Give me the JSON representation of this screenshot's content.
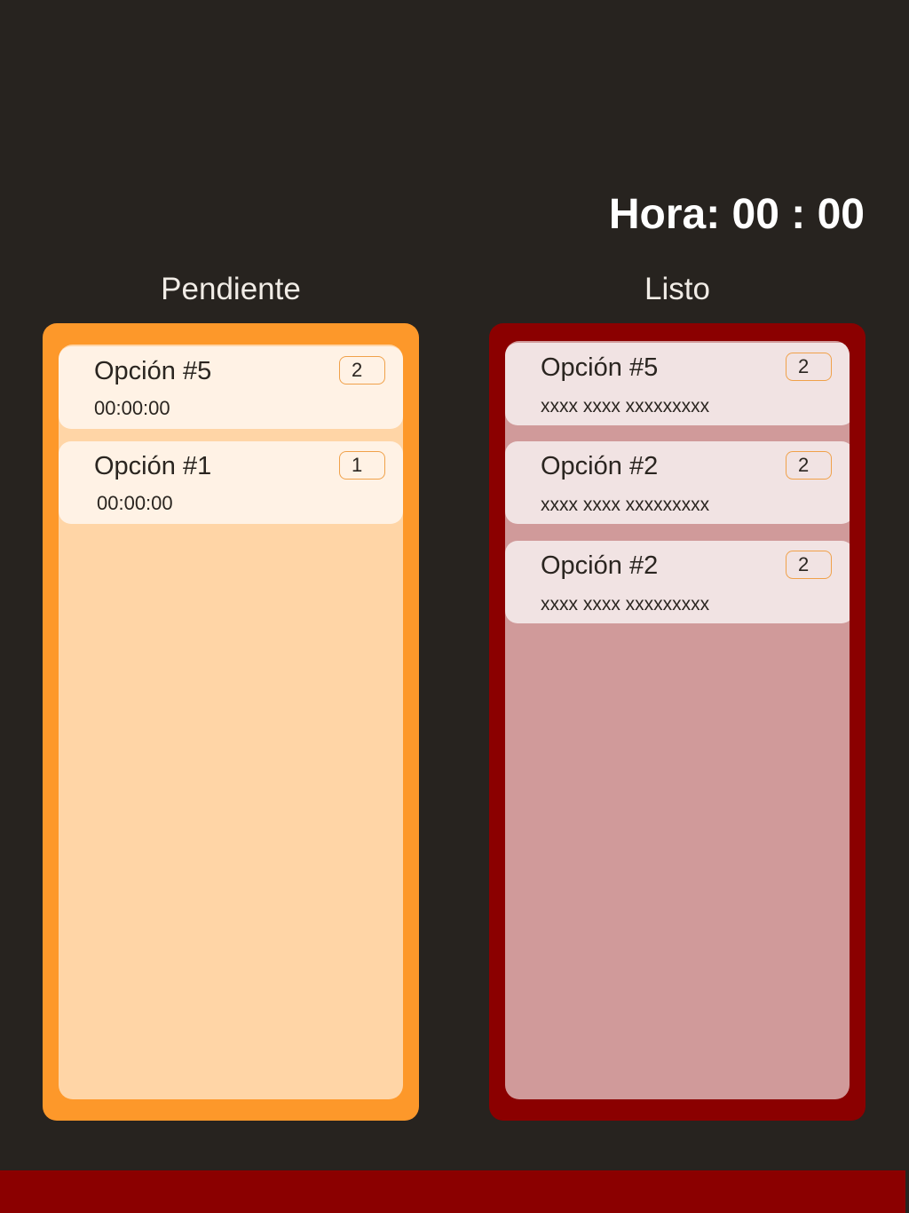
{
  "header": {
    "clock_text": "Hora: 00 : 00"
  },
  "columns": {
    "pending": {
      "title": "Pendiente",
      "cards": [
        {
          "title": "Opción #5",
          "qty": "2",
          "subtitle": "00:00:00"
        },
        {
          "title": "Opción #1",
          "qty": "1",
          "subtitle": "00:00:00"
        }
      ]
    },
    "done": {
      "title": "Listo",
      "cards": [
        {
          "title": "Opción #5",
          "qty": "2",
          "subtitle": "xxxx xxxx xxxxxxxxx"
        },
        {
          "title": "Opción #2",
          "qty": "2",
          "subtitle": "xxxx xxxx xxxxxxxxx"
        },
        {
          "title": "Opción #2",
          "qty": "2",
          "subtitle": "xxxx xxxx xxxxxxxxx"
        }
      ]
    }
  },
  "colors": {
    "background": "#27231f",
    "pending_accent": "#fd982a",
    "pending_panel": "#ffd5a6",
    "done_accent": "#8b0000",
    "done_panel": "#d09a9a",
    "qty_border": "#f0a14a"
  }
}
